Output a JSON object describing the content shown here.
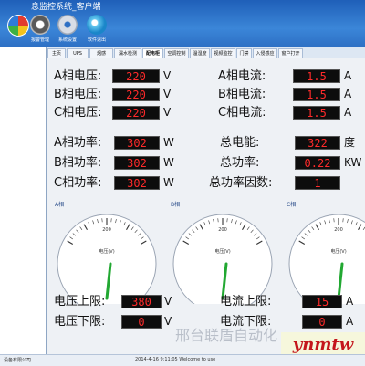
{
  "window": {
    "title": "息监控系统_客户端"
  },
  "toolbar": [
    {
      "label": "",
      "icon": "pie-chart-icon"
    },
    {
      "label": "报警管理",
      "icon": "speaker-icon"
    },
    {
      "label": "系统设置",
      "icon": "gear-icon"
    },
    {
      "label": "软件退出",
      "icon": "exit-icon"
    }
  ],
  "sidebar": {
    "items": [
      "",
      "",
      "",
      "",
      "",
      "",
      "",
      "",
      ""
    ]
  },
  "tabs": [
    "主页",
    "UPS",
    "烟感",
    "漏水检测",
    "配电柜",
    "空调控制",
    "温湿度",
    "视频监控",
    "门禁",
    "入侵感应",
    "窗户打开"
  ],
  "power": {
    "voltage": [
      {
        "label": "A相电压:",
        "value": "220",
        "unit": "V"
      },
      {
        "label": "B相电压:",
        "value": "220",
        "unit": "V"
      },
      {
        "label": "C相电压:",
        "value": "220",
        "unit": "V"
      }
    ],
    "current": [
      {
        "label": "A相电流:",
        "value": "1.5",
        "unit": "A"
      },
      {
        "label": "B相电流:",
        "value": "1.5",
        "unit": "A"
      },
      {
        "label": "C相电流:",
        "value": "1.5",
        "unit": "A"
      }
    ],
    "phase_power": [
      {
        "label": "A相功率:",
        "value": "302",
        "unit": "W"
      },
      {
        "label": "B相功率:",
        "value": "302",
        "unit": "W"
      },
      {
        "label": "C相功率:",
        "value": "302",
        "unit": "W"
      }
    ],
    "totals": [
      {
        "label": "总电能:",
        "value": "322",
        "unit": "度"
      },
      {
        "label": "总功率:",
        "value": "0.22",
        "unit": "KW"
      },
      {
        "label": "总功率因数:",
        "value": "1",
        "unit": ""
      }
    ]
  },
  "gauges": [
    {
      "title": "A相",
      "center_label": "电压(V)",
      "top_tick": "200",
      "needle_fraction": 0.62
    },
    {
      "title": "B相",
      "center_label": "电压(V)",
      "top_tick": "200",
      "needle_fraction": 0.62
    },
    {
      "title": "C相",
      "center_label": "电压(V)",
      "top_tick": "200",
      "needle_fraction": 0.62
    }
  ],
  "limits": {
    "voltage_upper": {
      "label": "电压上限:",
      "value": "380",
      "unit": "V"
    },
    "voltage_lower": {
      "label": "电压下限:",
      "value": "0",
      "unit": "V"
    },
    "current_upper": {
      "label": "电流上限:",
      "value": "15",
      "unit": "A"
    },
    "current_lower": {
      "label": "电流下限:",
      "value": "0",
      "unit": "A"
    }
  },
  "status": {
    "left": "设备有限公司",
    "right": "2014-4-16 9:11:05  Welcome to use"
  },
  "watermark": {
    "text": "邢台联盾自动化",
    "stamp": "ynmtw"
  },
  "colors": {
    "led_text": "#ff2a2a",
    "led_bg": "#0d0d0d",
    "needle": "#22a832",
    "header": "#2d6fc4"
  }
}
